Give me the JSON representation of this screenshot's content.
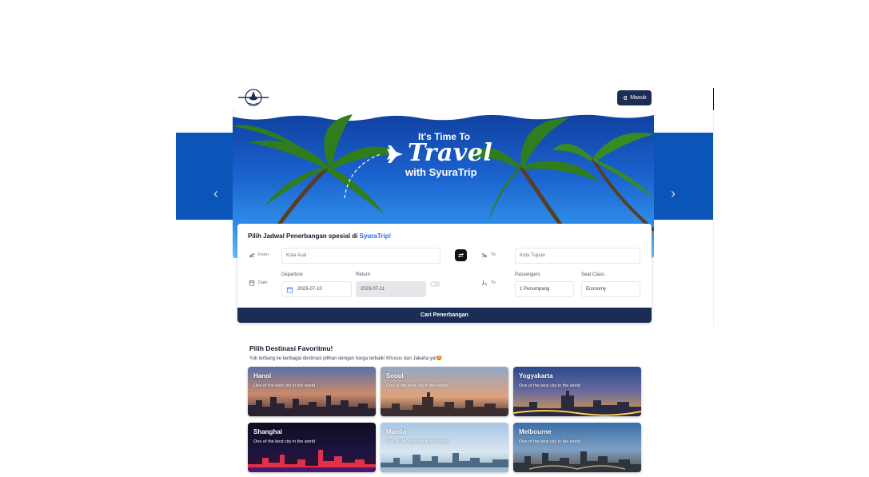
{
  "header": {
    "login_label": "Masuk"
  },
  "hero": {
    "line1": "It's Time To",
    "line2": "Travel",
    "line3": "with SyuraTrip"
  },
  "search": {
    "heading_prefix": "Pilih Jadwal Penerbangan spesial di ",
    "heading_brand": "SyuraTrip!",
    "from_label": "From",
    "from_placeholder": "Kota Asal",
    "to_label": "To",
    "to_placeholder": "Kota Tujuan",
    "date_label": "Date",
    "departure_label": "Departure",
    "departure_value": "2023-07-10",
    "return_label": "Return",
    "return_value": "2023-07-11",
    "passenger_icon_label": "To",
    "passengers_label": "Passengers",
    "passengers_value": "1 Penumpang",
    "seat_class_label": "Seat Class",
    "seat_class_value": "Economy",
    "submit_label": "Cari Penerbangan"
  },
  "destinations": {
    "title": "Pilih Destinasi Favoritmu!",
    "subtitle": "Yuk terbang ke berbagai destinasi pilihan dengan harga terbaik! Khusus dari Jakarta ya!🤩",
    "items": [
      {
        "name": "Hanoi",
        "desc": "One of the best city in the world"
      },
      {
        "name": "Seoul",
        "desc": "One of the best city in the world"
      },
      {
        "name": "Yogyakarta",
        "desc": "One of the best city in the world"
      },
      {
        "name": "Shanghai",
        "desc": "One of the best city in the world"
      },
      {
        "name": "Manila",
        "desc": "One of the best city in the world"
      },
      {
        "name": "Melbourne",
        "desc": "One of the best city in the world"
      }
    ]
  },
  "colors": {
    "navy": "#1b2d55",
    "accent": "#2563eb",
    "hero_blue": "#0b55b8"
  }
}
